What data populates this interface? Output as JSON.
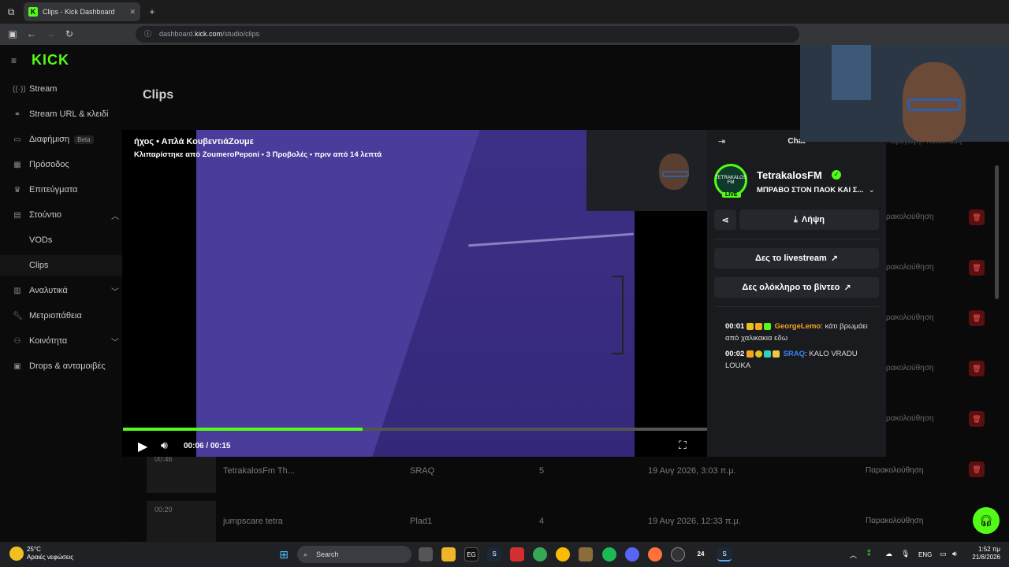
{
  "browser": {
    "tab_title": "Clips - Kick Dashboard",
    "favicon_letter": "K",
    "url_prefix": "dashboard.",
    "url_host": "kick.com",
    "url_path": "/studio/clips"
  },
  "sidebar": {
    "logo": "KICK",
    "items": [
      {
        "label": "Stream",
        "icon": "broadcast-icon"
      },
      {
        "label": "Stream URL & κλειδί",
        "icon": "link-icon"
      },
      {
        "label": "Διαφήμιση",
        "icon": "ad-icon",
        "badge": "Beta"
      },
      {
        "label": "Πρόσοδος",
        "icon": "revenue-icon"
      },
      {
        "label": "Επιτεύγματα",
        "icon": "trophy-icon"
      },
      {
        "label": "Στούντιο",
        "icon": "studio-icon"
      },
      {
        "label": "VODs"
      },
      {
        "label": "Clips"
      },
      {
        "label": "Αναλυτικά",
        "icon": "analytics-icon"
      },
      {
        "label": "Μετριοπάθεια",
        "icon": "wrench-icon"
      },
      {
        "label": "Κοινότητα",
        "icon": "community-icon"
      },
      {
        "label": "Drops & ανταμοιβές",
        "icon": "gift-icon"
      }
    ]
  },
  "page": {
    "title": "Clips",
    "rows": [
      {
        "title": "TetrakalosFm Th...",
        "creator": "SRAQ",
        "views": "5",
        "date": "19 Αυγ 2026, 3:03 π.μ.",
        "action": "Παρακολούθηση",
        "duration": "00:46"
      },
      {
        "title": "jumpscare tetra",
        "creator": "Plad1",
        "views": "4",
        "date": "19 Αυγ 2026, 12:33 π.μ.",
        "action": "Παρακολούθηση",
        "duration": "00:20"
      }
    ],
    "partial_action": "ρακολούθηση",
    "header_partial": "Παραγωγή / Κατάσταση"
  },
  "player": {
    "title": "ήχος • Απλά ΚουβεντιάΖουμε",
    "subtitle": "Κλιπαρίστηκε από ZoumeroPeponi • 3 Προβολές • πριν από 14 λεπτά",
    "time": "00:06 / 00:15",
    "progress": 0.41
  },
  "chat": {
    "header": "Chat",
    "channel": "TetrakalosFM",
    "avatar_text": "TETRAKALOS FM",
    "live": "LIVE",
    "stream_title": "ΜΠΡΑΒΟ ΣΤΟΝ ΠΑΟΚ ΚΑΙ Σ...",
    "download": "Λήψη",
    "watch_live": "Δες το livestream",
    "watch_full": "Δες ολόκληρο το βίντεο",
    "messages": [
      {
        "time": "00:01",
        "user": "GeorgeLemo",
        "user_color": "#f5a524",
        "text": "κάτι βρωμάει από χαλικακια εδω"
      },
      {
        "time": "00:02",
        "user": "SRAQ",
        "user_color": "#3b82f6",
        "text": "KALO VRADU LOUKA"
      }
    ]
  },
  "taskbar": {
    "temp": "25°C",
    "weather": "Αραιές νεφώσεις",
    "search": "Search",
    "lang": "ENG",
    "time": "1:52 πμ",
    "date": "21/8/2026"
  },
  "colors": {
    "accent": "#53fc18",
    "danger": "#5a1010"
  }
}
